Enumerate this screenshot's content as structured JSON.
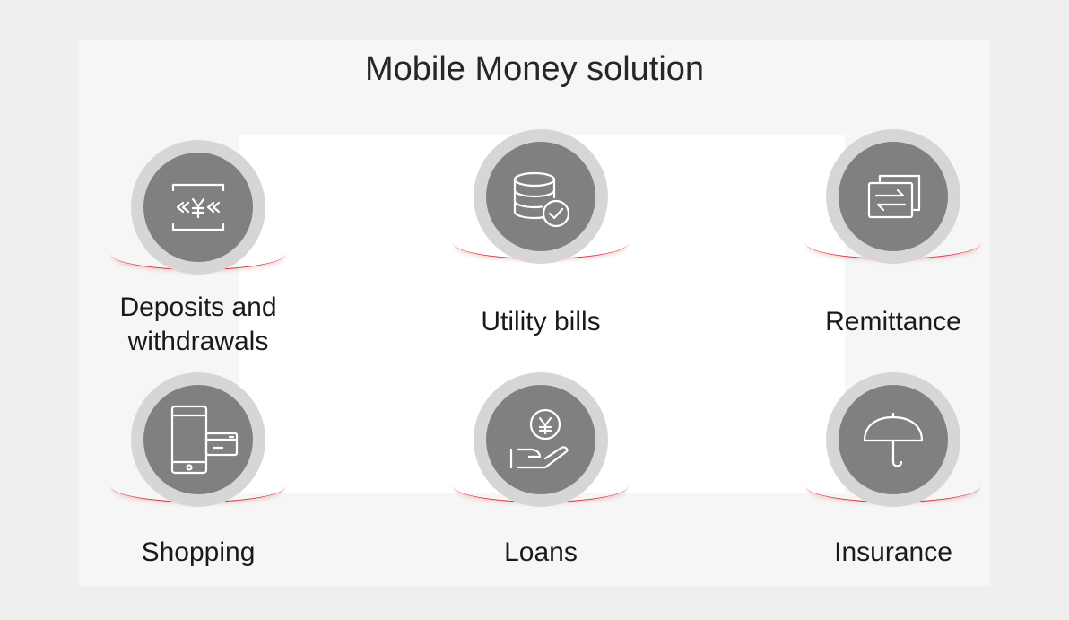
{
  "title": "Mobile Money solution",
  "items": [
    {
      "label": "Deposits and withdrawals",
      "label_line1": "Deposits and",
      "label_line2": "withdrawals",
      "icon": "deposit-exchange-icon"
    },
    {
      "label": "Utility bills",
      "icon": "database-check-icon"
    },
    {
      "label": "Remittance",
      "icon": "transfer-card-icon"
    },
    {
      "label": "Shopping",
      "icon": "phone-card-icon"
    },
    {
      "label": "Loans",
      "icon": "hand-coin-icon"
    },
    {
      "label": "Insurance",
      "icon": "umbrella-icon"
    }
  ],
  "colors": {
    "accent": "#d8323a",
    "icon_bg": "#808080",
    "ring": "#d6d6d6"
  }
}
